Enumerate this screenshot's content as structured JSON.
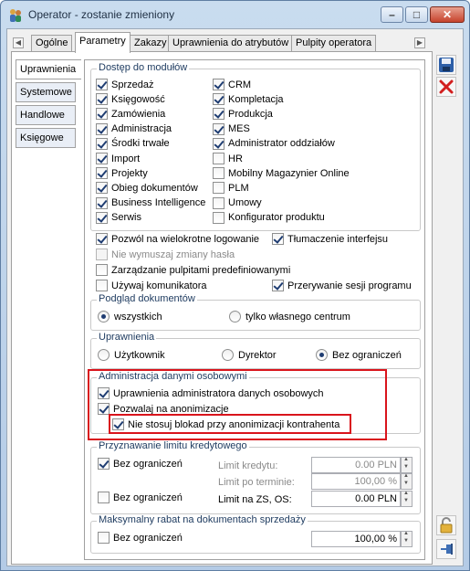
{
  "window": {
    "title": "Operator - zostanie zmieniony"
  },
  "tabs": [
    "Ogólne",
    "Parametry",
    "Zakazy",
    "Uprawnienia do atrybutów",
    "Pulpity operatora"
  ],
  "vtabs": [
    "Uprawnienia",
    "Systemowe",
    "Handlowe",
    "Księgowe"
  ],
  "modules": {
    "title": "Dostęp do modułów",
    "left": [
      {
        "label": "Sprzedaż",
        "checked": true
      },
      {
        "label": "Księgowość",
        "checked": true
      },
      {
        "label": "Zamówienia",
        "checked": true
      },
      {
        "label": "Administracja",
        "checked": true
      },
      {
        "label": "Środki trwałe",
        "checked": true
      },
      {
        "label": "Import",
        "checked": true
      },
      {
        "label": "Projekty",
        "checked": true
      },
      {
        "label": "Obieg dokumentów",
        "checked": true
      },
      {
        "label": "Business Intelligence",
        "checked": true
      },
      {
        "label": "Serwis",
        "checked": true
      }
    ],
    "right": [
      {
        "label": "CRM",
        "checked": true
      },
      {
        "label": "Kompletacja",
        "checked": true
      },
      {
        "label": "Produkcja",
        "checked": true
      },
      {
        "label": "MES",
        "checked": true
      },
      {
        "label": "Administrator oddziałów",
        "checked": true
      },
      {
        "label": "HR",
        "checked": false
      },
      {
        "label": "Mobilny Magazynier Online",
        "checked": false
      },
      {
        "label": "PLM",
        "checked": false
      },
      {
        "label": "Umowy",
        "checked": false
      },
      {
        "label": "Konfigurator produktu",
        "checked": false
      }
    ]
  },
  "options": {
    "multi_login": "Pozwól na wielokrotne logowanie",
    "translation": "Tłumaczenie interfejsu",
    "no_force_pw": "Nie wymuszaj zmiany hasła",
    "manage_desktops": "Zarządzanie pulpitami predefiniowanymi",
    "use_messenger": "Używaj komunikatora",
    "interrupt_sessions": "Przerywanie sesji programu"
  },
  "preview": {
    "title": "Podgląd dokumentów",
    "all": "wszystkich",
    "own": "tylko własnego centrum"
  },
  "permissions": {
    "title": "Uprawnienia",
    "user": "Użytkownik",
    "director": "Dyrektor",
    "unlimited": "Bez ograniczeń"
  },
  "personal_data": {
    "title": "Administracja danymi osobowymi",
    "admin_rights": "Uprawnienia administratora danych osobowych",
    "allow_anonymize": "Pozwalaj na anonimizacje",
    "no_locks": "Nie stosuj blokad przy anonimizacji kontrahenta"
  },
  "credit": {
    "title": "Przyznawanie limitu kredytowego",
    "unlimited_1": "Bez ograniczeń",
    "unlimited_2": "Bez ograniczeń",
    "limit_label": "Limit kredytu:",
    "limit_value": "0.00 PLN",
    "overdue_label": "Limit po terminie:",
    "overdue_value": "100,00 %",
    "zs_label": "Limit na ZS, OS:",
    "zs_value": "0.00 PLN"
  },
  "discount": {
    "title": "Maksymalny rabat na dokumentach sprzedaży",
    "unlimited": "Bez ograniczeń",
    "value": "100,00 %"
  },
  "colors": {
    "highlight": "#d9141c",
    "save": "#2d5fa8",
    "cancel": "#d21e1e"
  }
}
